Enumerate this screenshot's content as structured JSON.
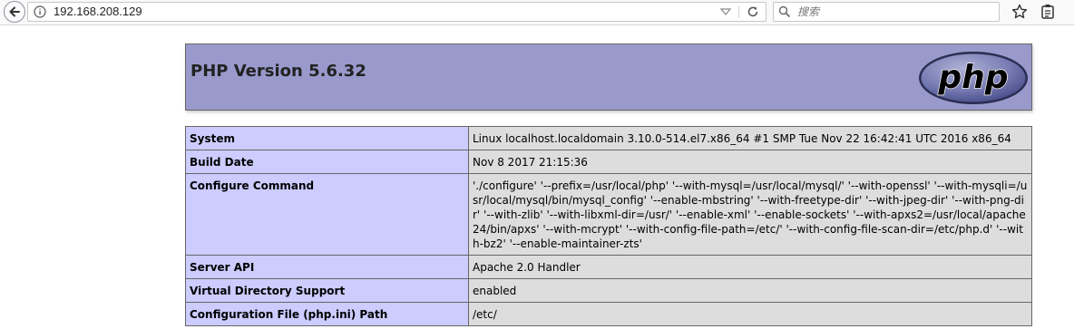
{
  "browser": {
    "url": "192.168.208.129",
    "search_placeholder": "搜索"
  },
  "php": {
    "title": "PHP Version 5.6.32",
    "logo_text": "php",
    "rows": [
      {
        "key": "System",
        "value": "Linux localhost.localdomain 3.10.0-514.el7.x86_64 #1 SMP Tue Nov 22 16:42:41 UTC 2016 x86_64"
      },
      {
        "key": "Build Date",
        "value": "Nov 8 2017 21:15:36"
      },
      {
        "key": "Configure Command",
        "value": "'./configure' '--prefix=/usr/local/php' '--with-mysql=/usr/local/mysql/' '--with-openssl' '--with-mysqli=/usr/local/mysql/bin/mysql_config' '--enable-mbstring' '--with-freetype-dir' '--with-jpeg-dir' '--with-png-dir' '--with-zlib' '--with-libxml-dir=/usr/' '--enable-xml' '--enable-sockets' '--with-apxs2=/usr/local/apache24/bin/apxs' '--with-mcrypt' '--with-config-file-path=/etc/' '--with-config-file-scan-dir=/etc/php.d' '--with-bz2' '--enable-maintainer-zts'"
      },
      {
        "key": "Server API",
        "value": "Apache 2.0 Handler"
      },
      {
        "key": "Virtual Directory Support",
        "value": "enabled"
      },
      {
        "key": "Configuration File (php.ini) Path",
        "value": "/etc/"
      }
    ]
  },
  "colors": {
    "header_bg": "#9999cc",
    "key_bg": "#ccccff",
    "value_bg": "#dddddd",
    "border": "#666666"
  }
}
